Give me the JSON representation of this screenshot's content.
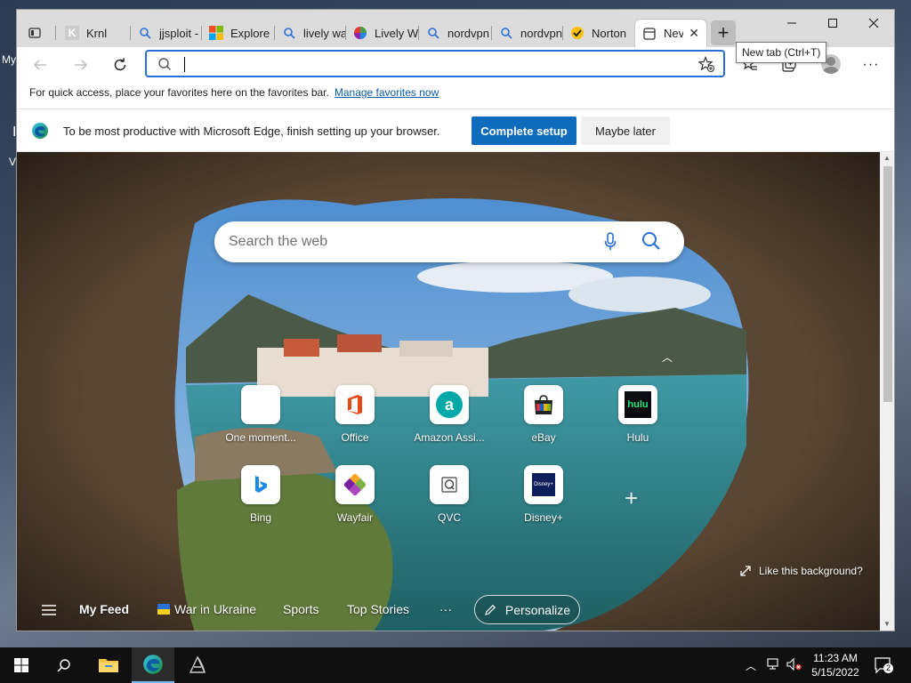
{
  "desktop": {
    "label_top": "My",
    "label_mid": "I",
    "label_low": "V"
  },
  "browser": {
    "tabs": [
      {
        "label": "",
        "icon": "tab-actions-icon"
      },
      {
        "label": "Krnl",
        "icon": "krnl-icon"
      },
      {
        "label": "jjsploit -",
        "icon": "search-icon"
      },
      {
        "label": "Explore",
        "icon": "microsoft-icon"
      },
      {
        "label": "lively wa",
        "icon": "search-icon"
      },
      {
        "label": "Lively W",
        "icon": "lively-icon"
      },
      {
        "label": "nordvpn",
        "icon": "search-icon"
      },
      {
        "label": "nordvpn",
        "icon": "search-icon"
      },
      {
        "label": "Norton",
        "icon": "norton-icon"
      },
      {
        "label": "Nev",
        "icon": "newtab-icon"
      }
    ],
    "tooltip": "New tab (Ctrl+T)",
    "address": {
      "value": "",
      "placeholder": ""
    },
    "favorites_bar": {
      "text": "For quick access, place your favorites here on the favorites bar.",
      "link": "Manage favorites now"
    },
    "banner": {
      "message": "To be most productive with Microsoft Edge, finish setting up your browser.",
      "primary": "Complete setup",
      "secondary": "Maybe later"
    }
  },
  "ntp": {
    "search_placeholder": "Search the web",
    "quick_links": [
      {
        "name": "One moment...",
        "icon": "loading-icon"
      },
      {
        "name": "Office",
        "icon": "office-icon"
      },
      {
        "name": "Amazon Assi...",
        "icon": "amazon-icon"
      },
      {
        "name": "eBay",
        "icon": "ebay-icon"
      },
      {
        "name": "Hulu",
        "icon": "hulu-icon"
      },
      {
        "name": "Bing",
        "icon": "bing-icon"
      },
      {
        "name": "Wayfair",
        "icon": "wayfair-icon"
      },
      {
        "name": "QVC",
        "icon": "qvc-icon"
      },
      {
        "name": "Disney+",
        "icon": "disney-icon"
      }
    ],
    "hulu_text": "hulu",
    "disney_text": "Disney+",
    "like_background": "Like this background?",
    "feed": {
      "my_feed": "My Feed",
      "items": [
        "War in Ukraine",
        "Sports",
        "Top Stories"
      ],
      "more": "···",
      "personalize": "Personalize"
    }
  },
  "taskbar": {
    "time": "11:23 AM",
    "date": "5/15/2022",
    "notifications": "2"
  },
  "colors": {
    "accent": "#0f6cbd",
    "tabstrip": "#dcdcdc",
    "taskbar": "#101010"
  }
}
